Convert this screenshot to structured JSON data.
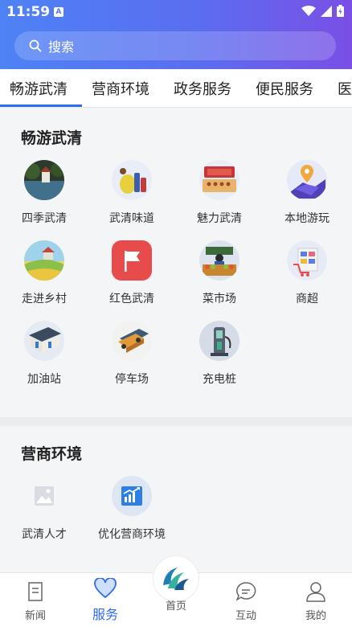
{
  "status_bar": {
    "time": "11:59",
    "badge": "A"
  },
  "search": {
    "placeholder": "搜索"
  },
  "tabs": [
    {
      "label": "畅游武清",
      "active": true
    },
    {
      "label": "营商环境"
    },
    {
      "label": "政务服务"
    },
    {
      "label": "便民服务"
    },
    {
      "label": "医"
    }
  ],
  "section_tour": {
    "title": "畅游武清",
    "items": [
      {
        "label": "四季武清",
        "icon": "lake-photo-icon"
      },
      {
        "label": "武清味道",
        "icon": "food-icon"
      },
      {
        "label": "魅力武清",
        "icon": "theater-icon"
      },
      {
        "label": "本地游玩",
        "icon": "map-pin-icon"
      },
      {
        "label": "走进乡村",
        "icon": "village-icon"
      },
      {
        "label": "红色武清",
        "icon": "red-flag-icon"
      },
      {
        "label": "菜市场",
        "icon": "market-icon"
      },
      {
        "label": "商超",
        "icon": "supermarket-icon"
      },
      {
        "label": "加油站",
        "icon": "gas-station-icon"
      },
      {
        "label": "停车场",
        "icon": "parking-icon"
      },
      {
        "label": "充电桩",
        "icon": "charging-pile-icon"
      }
    ]
  },
  "section_business": {
    "title": "营商环境",
    "items": [
      {
        "label": "武清人才",
        "icon": "image-placeholder-icon"
      },
      {
        "label": "优化营商环境",
        "icon": "chart-up-icon"
      }
    ]
  },
  "bottom_nav": [
    {
      "label": "新闻",
      "icon": "news-icon"
    },
    {
      "label": "服务",
      "icon": "heart-icon",
      "active": true
    },
    {
      "label": "首页",
      "icon": "home-logo-icon"
    },
    {
      "label": "互动",
      "icon": "chat-icon"
    },
    {
      "label": "我的",
      "icon": "user-icon"
    }
  ],
  "colors": {
    "accent": "#2f6bf0",
    "header_start": "#4e82f5",
    "header_end": "#7a4fe6",
    "red_icon": "#e84b4b"
  }
}
